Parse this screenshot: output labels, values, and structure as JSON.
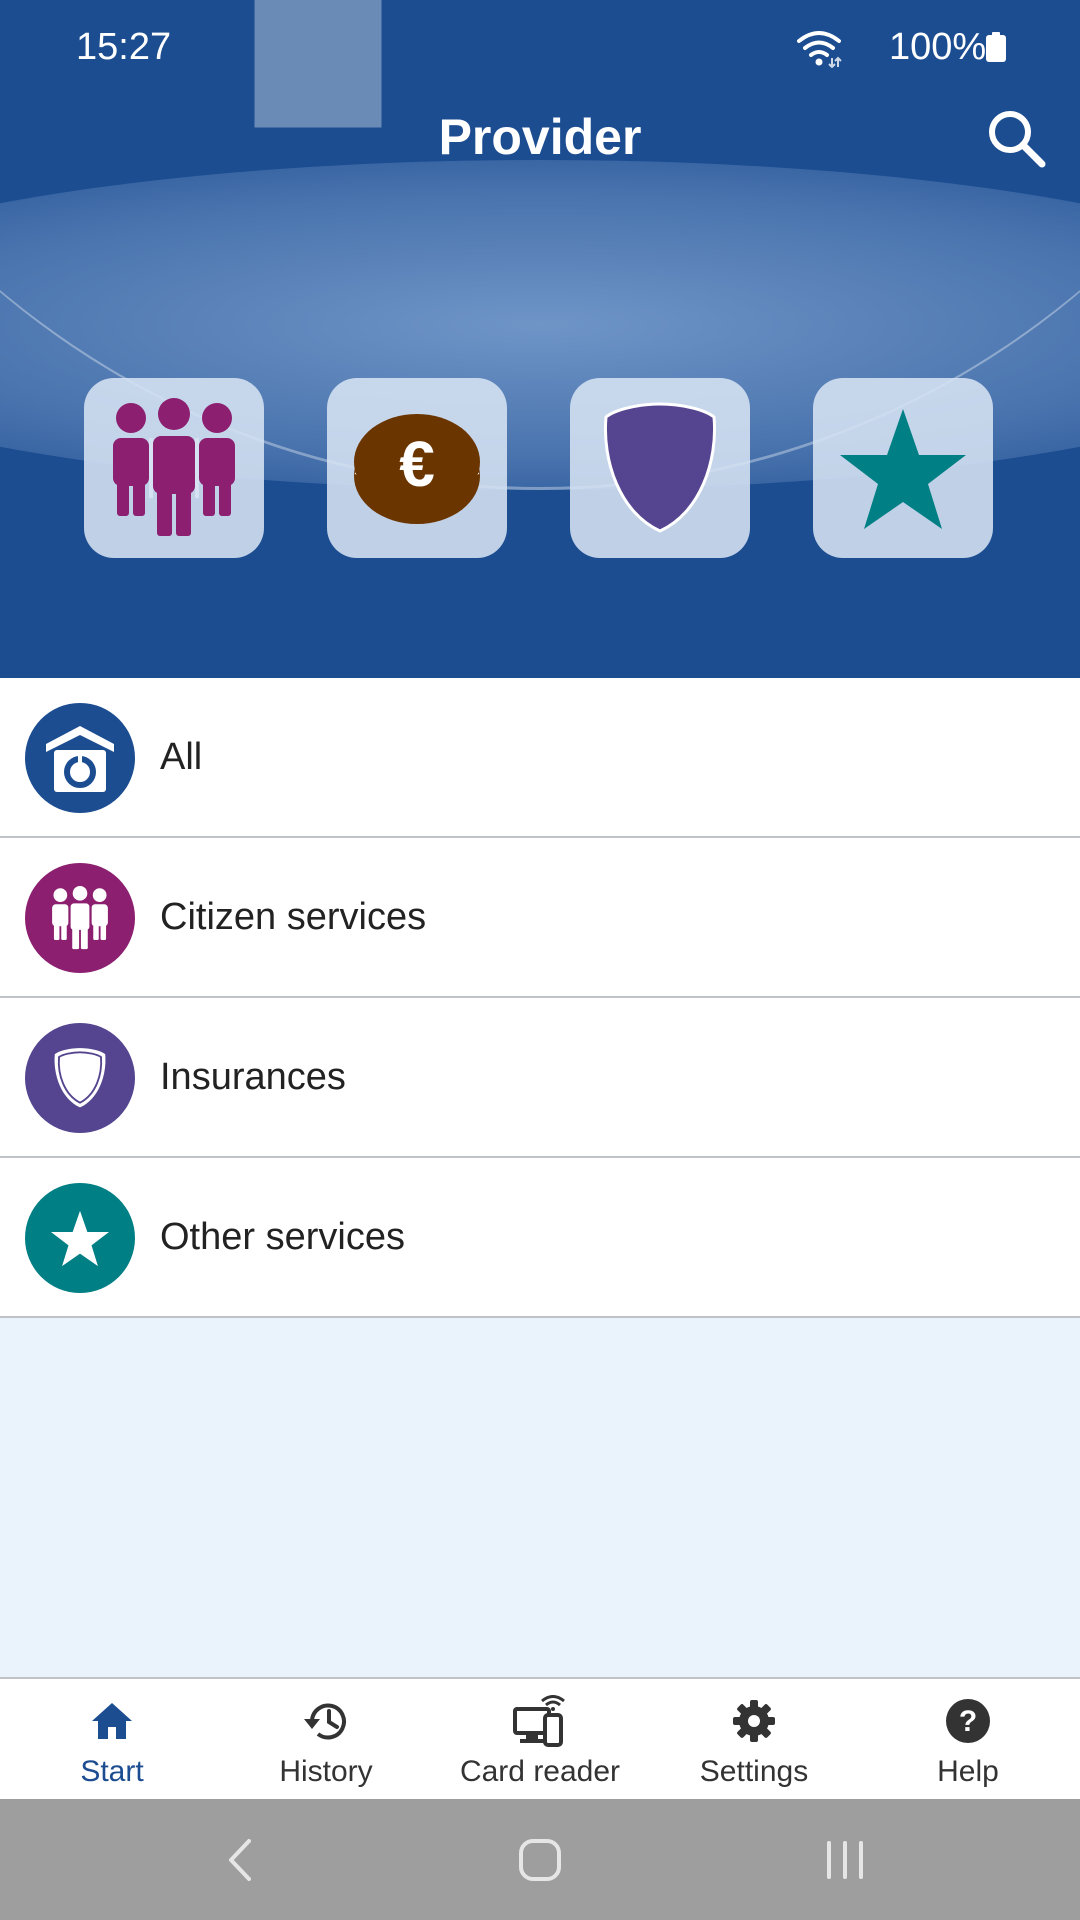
{
  "status_bar": {
    "time": "15:27",
    "battery": "100%"
  },
  "header": {
    "title": "Provider"
  },
  "categories": [
    "citizen-services",
    "payments",
    "insurances",
    "other-services"
  ],
  "list": {
    "items": [
      {
        "label": "All",
        "icon": "house-icon",
        "color": "#1c4d91"
      },
      {
        "label": "Citizen services",
        "icon": "people-icon",
        "color": "#8c1f6f"
      },
      {
        "label": "Insurances",
        "icon": "shield-icon",
        "color": "#55448f"
      },
      {
        "label": "Other services",
        "icon": "star-icon",
        "color": "#007f84"
      }
    ]
  },
  "bottom_nav": {
    "items": [
      {
        "label": "Start",
        "icon": "home-icon",
        "active": true
      },
      {
        "label": "History",
        "icon": "history-icon"
      },
      {
        "label": "Card reader",
        "icon": "card-reader-icon"
      },
      {
        "label": "Settings",
        "icon": "gear-icon"
      },
      {
        "label": "Help",
        "icon": "help-icon"
      }
    ]
  },
  "colors": {
    "header": "#1c4d91",
    "citizen": "#8c1f6f",
    "euro_coin": "#6b3500",
    "insurance": "#55448f",
    "other": "#007f84",
    "background": "#eaf2fc"
  }
}
